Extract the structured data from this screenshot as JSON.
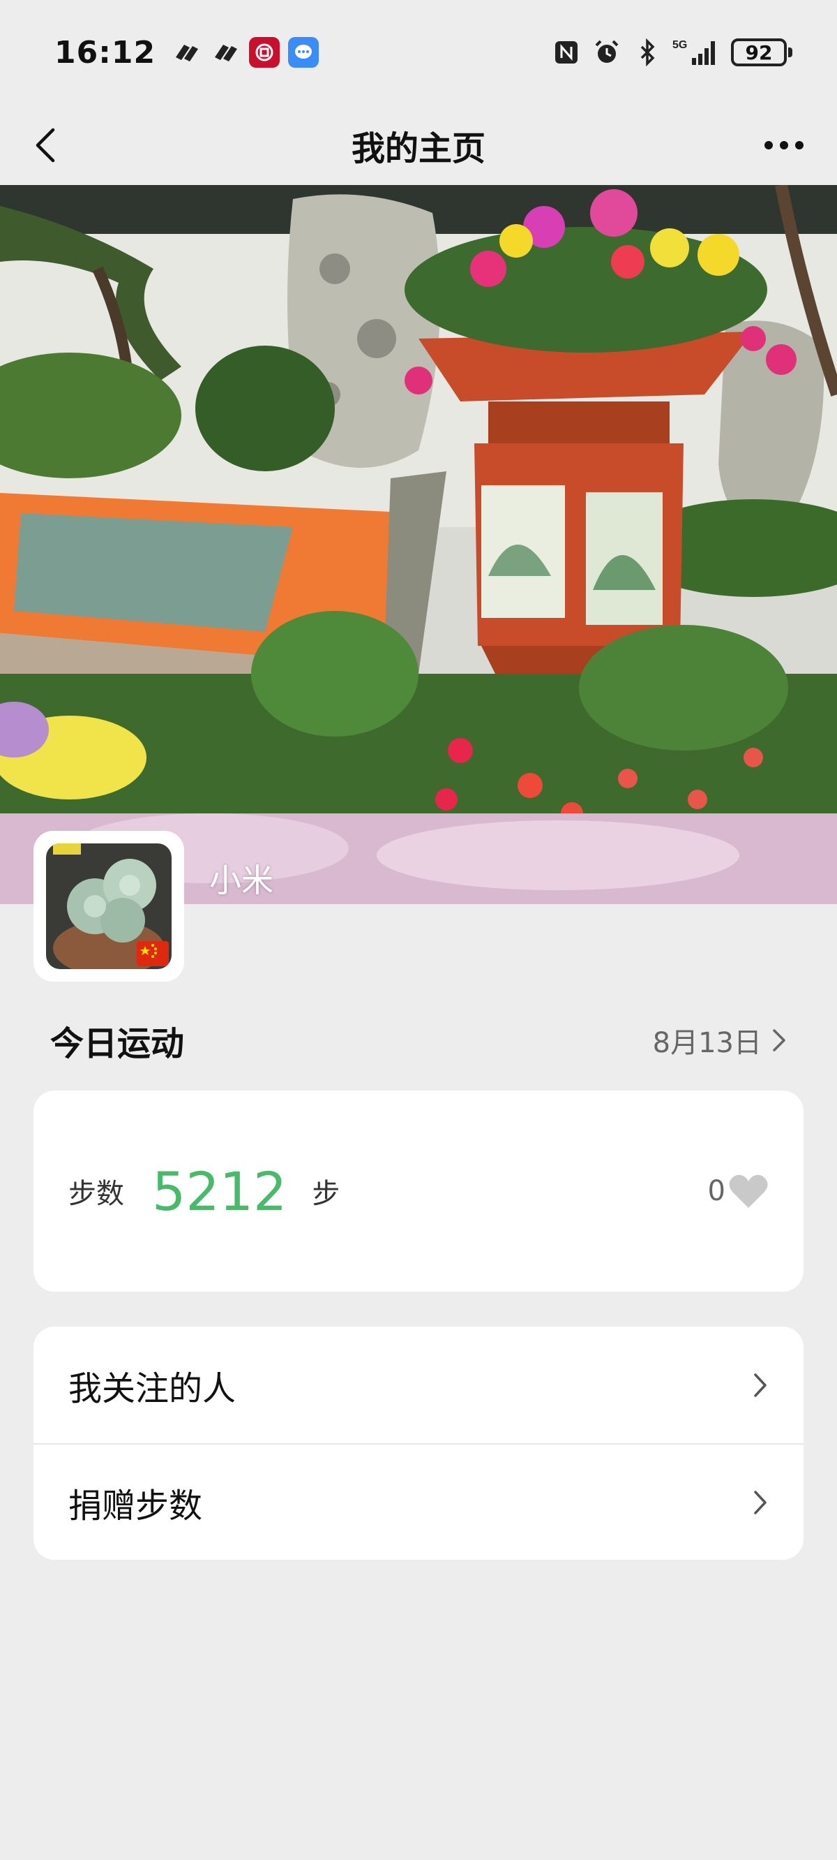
{
  "status_bar": {
    "time": "16:12",
    "network": "5G",
    "battery": "92"
  },
  "nav": {
    "title": "我的主页"
  },
  "profile": {
    "username": "小米"
  },
  "today": {
    "title": "今日运动",
    "date": "8月13日"
  },
  "steps": {
    "label": "步数",
    "value": "5212",
    "unit": "步",
    "likes": "0"
  },
  "list": [
    {
      "label": "我关注的人"
    },
    {
      "label": "捐赠步数"
    }
  ],
  "colors": {
    "accent_green": "#49b96a",
    "background": "#ededed",
    "card": "#ffffff"
  }
}
